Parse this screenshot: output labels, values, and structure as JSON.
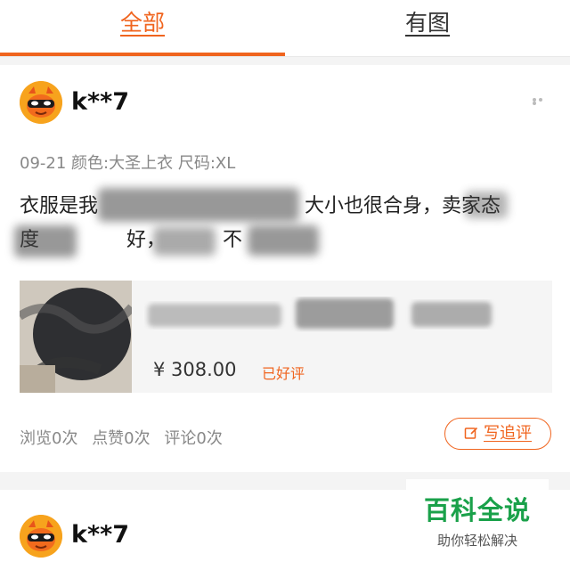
{
  "tabs": {
    "all": "全部",
    "with_images": "有图"
  },
  "reviews": [
    {
      "username": "k**7",
      "date": "09-21",
      "specs": "颜色:大圣上衣  尺码:XL",
      "text_line1": "衣服是我",
      "text_line1_mid": "大小也很合身，卖家态",
      "text_line2": "度",
      "text_line2_mid": "好，",
      "text_line2_end": "不",
      "product": {
        "price": "¥ 308.00",
        "rating": "已好评"
      },
      "stats": {
        "views": "浏览0次",
        "likes": "点赞0次",
        "comments": "评论0次"
      },
      "followup_label": "写追评"
    },
    {
      "username": "k**7"
    }
  ],
  "watermark": {
    "title": "百科全说",
    "subtitle": "助你轻松解决"
  },
  "colors": {
    "accent": "#f0641e",
    "watermark_green": "#1aa14a"
  }
}
